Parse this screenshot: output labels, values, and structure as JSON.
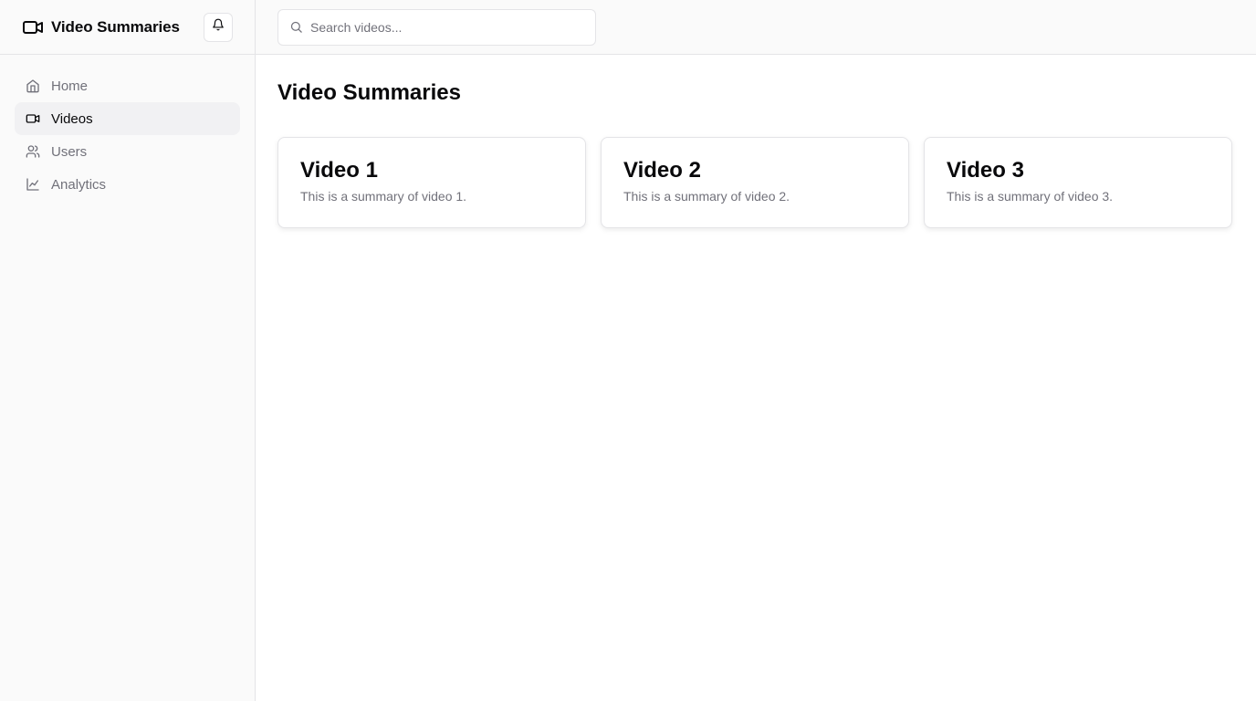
{
  "app": {
    "title": "Video Summaries",
    "brand_icon": "video-camera-icon",
    "notification_icon": "bell-icon"
  },
  "sidebar": {
    "items": [
      {
        "label": "Home",
        "icon": "home-icon",
        "active": false
      },
      {
        "label": "Videos",
        "icon": "video-camera-icon",
        "active": true
      },
      {
        "label": "Users",
        "icon": "users-icon",
        "active": false
      },
      {
        "label": "Analytics",
        "icon": "line-chart-icon",
        "active": false
      }
    ]
  },
  "search": {
    "placeholder": "Search videos...",
    "value": "",
    "icon": "search-icon"
  },
  "main": {
    "page_title": "Video Summaries",
    "cards": [
      {
        "title": "Video 1",
        "summary": "This is a summary of video 1."
      },
      {
        "title": "Video 2",
        "summary": "This is a summary of video 2."
      },
      {
        "title": "Video 3",
        "summary": "This is a summary of video 3."
      }
    ]
  },
  "colors": {
    "background": "#ffffff",
    "sidebar_bg": "#fafafa",
    "border": "#e4e4e7",
    "text": "#09090b",
    "muted_text": "#71717a",
    "active_item_bg": "#f1f1f3"
  }
}
